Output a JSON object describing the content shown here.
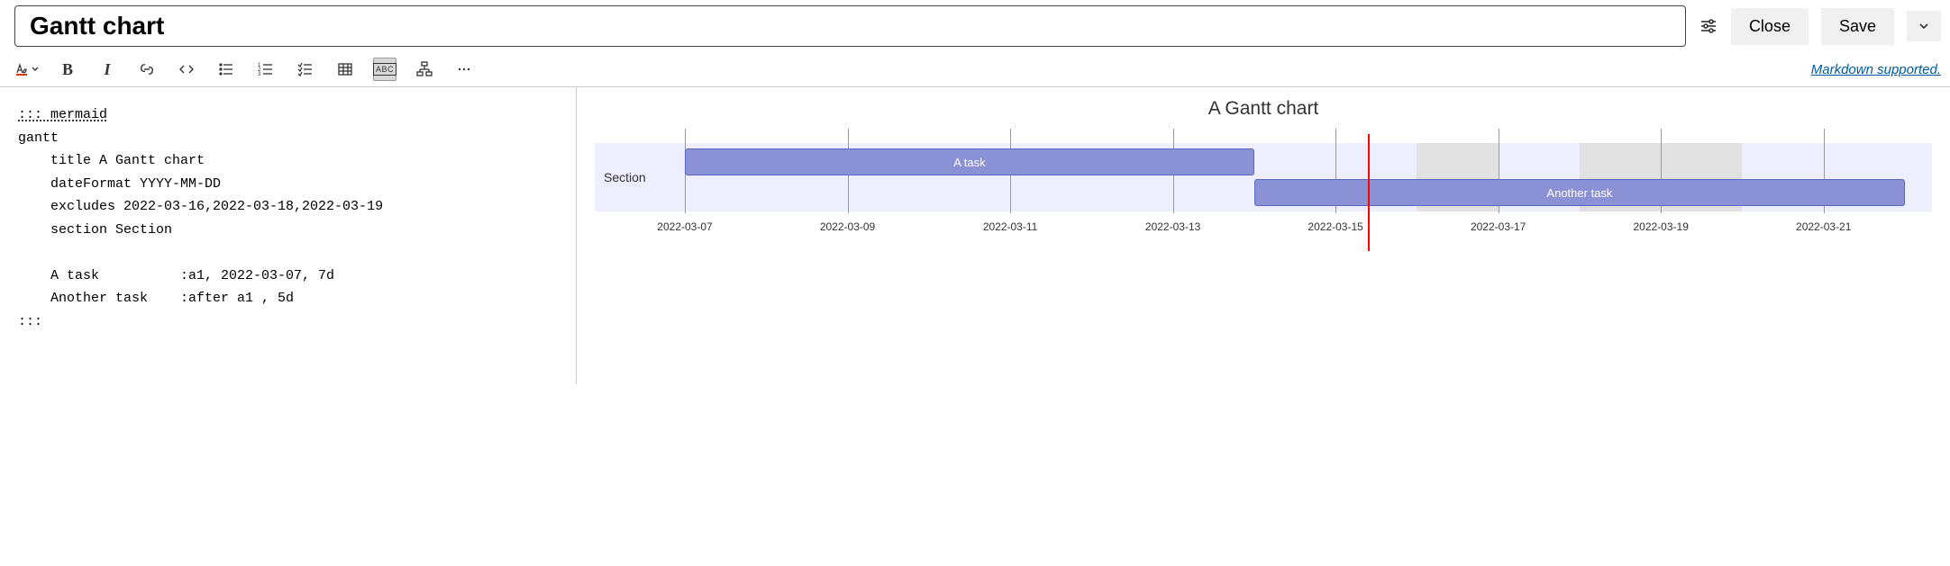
{
  "header": {
    "title": "Gantt chart",
    "close_label": "Close",
    "save_label": "Save"
  },
  "toolbar": {
    "markdown_link": "Markdown supported."
  },
  "editor": {
    "fence_open": "::: mermaid",
    "lines": [
      "gantt",
      "    title A Gantt chart",
      "    dateFormat YYYY-MM-DD",
      "    excludes 2022-03-16,2022-03-18,2022-03-19",
      "    section Section",
      "",
      "    A task          :a1, 2022-03-07, 7d",
      "    Another task    :after a1 , 5d"
    ],
    "fence_close": ":::"
  },
  "chart_data": {
    "type": "gantt",
    "title": "A Gantt chart",
    "section_label": "Section",
    "date_range": [
      "2022-03-07",
      "2022-03-22"
    ],
    "today": "2022-03-15",
    "excludes": [
      "2022-03-16",
      "2022-03-18",
      "2022-03-19"
    ],
    "ticks": [
      "2022-03-07",
      "2022-03-09",
      "2022-03-11",
      "2022-03-13",
      "2022-03-15",
      "2022-03-17",
      "2022-03-19",
      "2022-03-21"
    ],
    "tasks": [
      {
        "name": "A task",
        "start": "2022-03-07",
        "duration_days": 7
      },
      {
        "name": "Another task",
        "start": "2022-03-14",
        "duration_days": 8
      }
    ],
    "colors": {
      "bar_fill": "#8a91d4",
      "bar_stroke": "#5a66c4",
      "row_bg": "#edeeff",
      "excl_bg": "#e1e1e1",
      "today_line": "#ff0000"
    }
  }
}
